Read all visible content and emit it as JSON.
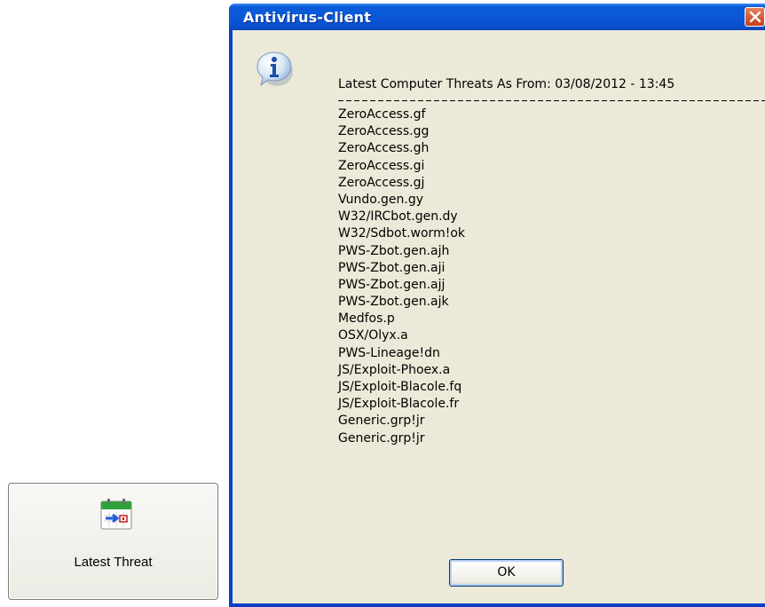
{
  "launcher": {
    "label": "Latest Threat",
    "icon": "calendar-arrow-icon",
    "icon_badge": "grp"
  },
  "dialog": {
    "title": "Antivirus-Client",
    "close_icon": "close-icon",
    "info_icon": "info-icon",
    "header": "Latest Computer Threats As From: 03/08/2012 - 13:45",
    "threats": [
      "ZeroAccess.gf",
      "ZeroAccess.gg",
      "ZeroAccess.gh",
      "ZeroAccess.gi",
      "ZeroAccess.gj",
      "Vundo.gen.gy",
      "W32/IRCbot.gen.dy",
      "W32/Sdbot.worm!ok",
      "PWS-Zbot.gen.ajh",
      "PWS-Zbot.gen.aji",
      "PWS-Zbot.gen.ajj",
      "PWS-Zbot.gen.ajk",
      "Medfos.p",
      "OSX/Olyx.a",
      "PWS-Lineage!dn",
      "JS/Exploit-Phoex.a",
      "JS/Exploit-Blacole.fq",
      "JS/Exploit-Blacole.fr",
      "Generic.grp!jr",
      "Generic.grp!jr"
    ],
    "ok_label": "OK"
  },
  "colors": {
    "titlebar": "#0a58d8",
    "window_face": "#ece9d8",
    "close_button": "#d9552f"
  }
}
